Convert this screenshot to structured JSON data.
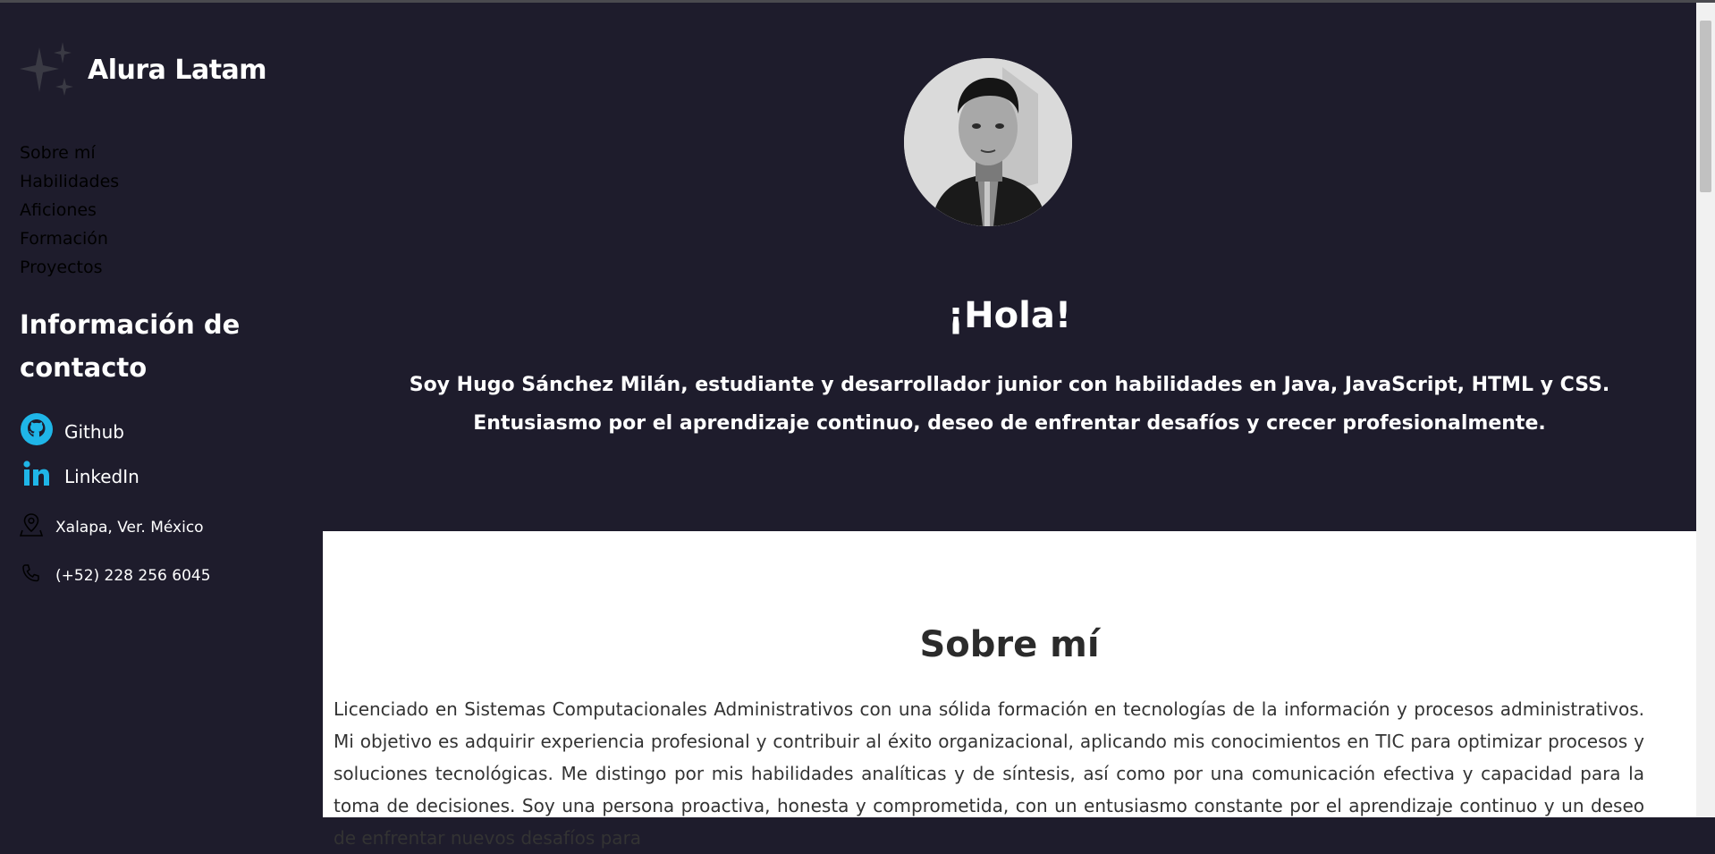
{
  "brand": {
    "name": "Alura Latam"
  },
  "nav": {
    "items": [
      "Sobre mí",
      "Habilidades",
      "Aficiones",
      "Formación",
      "Proyectos"
    ]
  },
  "contact": {
    "title": "Información de contacto",
    "github_label": "Github",
    "linkedin_label": "LinkedIn",
    "location": "Xalapa, Ver. México",
    "phone": "(+52) 228 256 6045"
  },
  "hero": {
    "greeting": "¡Hola!",
    "intro": "Soy Hugo Sánchez Milán, estudiante y desarrollador junior con habilidades en Java, JavaScript, HTML y CSS. Entusiasmo por el aprendizaje continuo, deseo de enfrentar desafíos y crecer profesionalmente."
  },
  "about": {
    "title": "Sobre mí",
    "text": "Licenciado en Sistemas Computacionales Administrativos con una sólida formación en tecnologías de la información y procesos administrativos. Mi objetivo es adquirir experiencia profesional y contribuir al éxito organizacional, aplicando mis conocimientos en TIC para optimizar procesos y soluciones tecnológicas. Me distingo por mis habilidades analíticas y de síntesis, así como por una comunicación efectiva y capacidad para la toma de decisiones. Soy una persona proactiva, honesta y comprometida, con un entusiasmo constante por el aprendizaje continuo y un deseo de enfrentar nuevos desafíos para"
  },
  "colors": {
    "background": "#1e1c2c",
    "accent": "#1fb6e8",
    "text_light": "#ffffff",
    "section_bg": "#ffffff"
  }
}
